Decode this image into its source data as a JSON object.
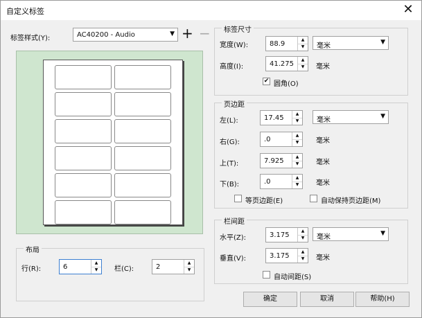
{
  "window": {
    "title": "自定义标签"
  },
  "label_style": {
    "label": "标签样式(Y):",
    "value": "AC40200 - Audio"
  },
  "label_size": {
    "title": "标签尺寸",
    "width_label": "宽度(W):",
    "width_value": "88.9",
    "unit_combo": "毫米",
    "height_label": "高度(I):",
    "height_value": "41.275",
    "height_unit": "毫米",
    "rounded_label": "圆角(O)",
    "rounded_checked": true
  },
  "margins": {
    "title": "页边距",
    "left_label": "左(L):",
    "left_value": "17.45",
    "unit_combo": "毫米",
    "right_label": "右(G):",
    "right_value": ".0",
    "right_unit": "毫米",
    "top_label": "上(T):",
    "top_value": "7.925",
    "top_unit": "毫米",
    "bottom_label": "下(B):",
    "bottom_value": ".0",
    "bottom_unit": "毫米",
    "equal_label": "等页边距(E)",
    "auto_label": "自动保持页边距(M)"
  },
  "gutter": {
    "title": "栏间距",
    "horizontal_label": "水平(Z):",
    "horizontal_value": "3.175",
    "unit_combo": "毫米",
    "vertical_label": "垂直(V):",
    "vertical_value": "3.175",
    "vertical_unit": "毫米",
    "auto_label": "自动间距(S)"
  },
  "layout": {
    "title": "布局",
    "rows_label": "行(R):",
    "rows_value": "6",
    "cols_label": "栏(C):",
    "cols_value": "2"
  },
  "buttons": {
    "ok": "确定",
    "cancel": "取消",
    "help": "帮助(H)"
  },
  "preview": {
    "rows": 6,
    "cols": 2
  },
  "icons": {
    "add": "plus-icon",
    "remove": "minus-icon",
    "close": "close-icon"
  }
}
